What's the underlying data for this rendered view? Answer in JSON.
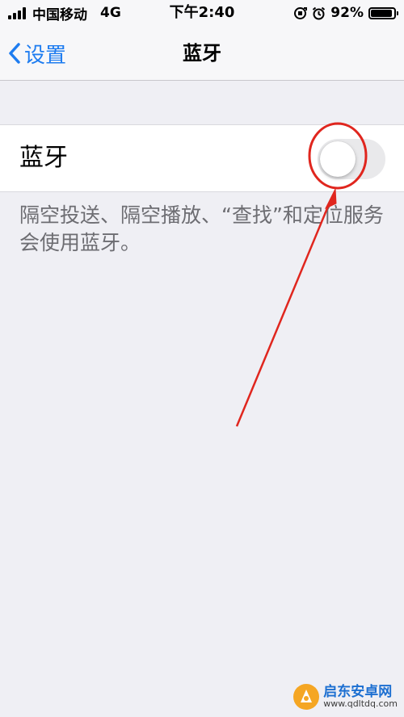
{
  "status_bar": {
    "carrier": "中国移动",
    "network": "4G",
    "time": "下午2:40",
    "battery_percent": "92%",
    "battery_level": 0.92
  },
  "nav": {
    "back_label": "设置",
    "title": "蓝牙"
  },
  "bluetooth": {
    "label": "蓝牙",
    "toggle_on": false,
    "footer": "隔空投送、隔空播放、“查找”和定位服务会使用蓝牙。"
  },
  "annotation_color": "#e0261e",
  "watermark": {
    "name": "启东安卓网",
    "url": "www.qdltdq.com"
  },
  "colors": {
    "accent": "#1e7cf0",
    "background": "#efeff4"
  }
}
